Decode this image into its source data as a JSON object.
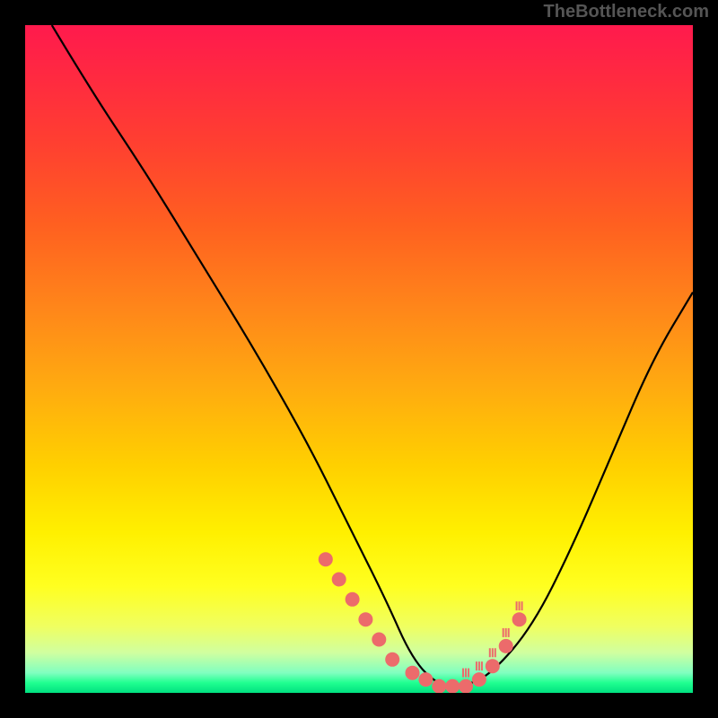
{
  "watermark": "TheBottleneck.com",
  "chart_data": {
    "type": "line",
    "title": "",
    "xlabel": "",
    "ylabel": "",
    "xlim": [
      0,
      100
    ],
    "ylim": [
      0,
      100
    ],
    "description": "V-shaped bottleneck curve over red-to-green vertical gradient background. Y maps to mismatch (top=high/red, bottom=low/green). Curve descends steeply from top-left to a flat minimum around x≈62 then rises toward upper-right. Salmon dots cluster near the minimum.",
    "series": [
      {
        "name": "bottleneck-curve",
        "x": [
          4,
          10,
          18,
          26,
          34,
          42,
          48,
          54,
          58,
          62,
          66,
          70,
          76,
          82,
          88,
          94,
          100
        ],
        "y": [
          100,
          90,
          78,
          65,
          52,
          38,
          26,
          14,
          5,
          1,
          1,
          3,
          10,
          22,
          36,
          50,
          60
        ]
      },
      {
        "name": "data-points",
        "x": [
          45,
          47,
          49,
          51,
          53,
          55,
          58,
          60,
          62,
          64,
          66,
          68,
          70,
          72,
          74
        ],
        "y": [
          20,
          17,
          14,
          11,
          8,
          5,
          3,
          2,
          1,
          1,
          1,
          2,
          4,
          7,
          11
        ]
      }
    ],
    "colors": {
      "curve": "#000000",
      "points": "#ec6b6b",
      "gradient_top": "#ff1a4d",
      "gradient_bottom": "#00e080"
    }
  }
}
